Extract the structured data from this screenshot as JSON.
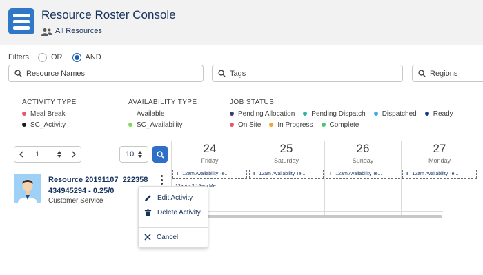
{
  "app": {
    "title": "Resource Roster Console",
    "subtitle": "All Resources"
  },
  "filters": {
    "label": "Filters:",
    "options": [
      {
        "label": "OR",
        "selected": false
      },
      {
        "label": "AND",
        "selected": true
      }
    ]
  },
  "search": {
    "resource_names": "Resource Names",
    "tags": "Tags",
    "regions": "Regions"
  },
  "legend": {
    "activity_type": {
      "heading": "ACTIVITY TYPE",
      "items": [
        {
          "label": "Meal Break",
          "color": "#e8556f"
        },
        {
          "label": "SC_Activity",
          "color": "#1a1a1a"
        }
      ]
    },
    "availability_type": {
      "heading": "AVAILABILITY TYPE",
      "items": [
        {
          "label": "Available",
          "color": ""
        },
        {
          "label": "SC_Availability",
          "color": "#7ed957"
        }
      ]
    },
    "job_status": {
      "heading": "JOB STATUS",
      "row1": [
        {
          "label": "Pending Allocation",
          "color": "#3a3f6b"
        },
        {
          "label": "Pending Dispatch",
          "color": "#2bb5a0"
        },
        {
          "label": "Dispatched",
          "color": "#3fa9e6"
        },
        {
          "label": "Ready",
          "color": "#163a8c"
        }
      ],
      "row2": [
        {
          "label": "On Site",
          "color": "#e8556f"
        },
        {
          "label": "In Progress",
          "color": "#f0a530"
        },
        {
          "label": "Complete",
          "color": "#4cc36c"
        }
      ]
    }
  },
  "controls": {
    "page": "1",
    "count": "10"
  },
  "days": [
    {
      "num": "24",
      "name": "Friday"
    },
    {
      "num": "25",
      "name": "Saturday"
    },
    {
      "num": "26",
      "name": "Sunday"
    },
    {
      "num": "27",
      "name": "Monday"
    }
  ],
  "resource": {
    "name_line1": "Resource 20191107_222358",
    "name_line2": "434945294 - 0.25/0",
    "team": "Customer Service"
  },
  "activities": [
    {
      "prefix": "T",
      "text": "12am Availability Te..."
    },
    {
      "prefix": "T",
      "text": "12am Availability Te..."
    },
    {
      "prefix": "T",
      "text": "12am Availability Te..."
    },
    {
      "prefix": "T",
      "text": "12am Availability Te..."
    }
  ],
  "activity_second": "12am - 2:15am Me...",
  "context_menu": {
    "edit": "Edit Activity",
    "delete": "Delete Activity",
    "cancel": "Cancel"
  }
}
